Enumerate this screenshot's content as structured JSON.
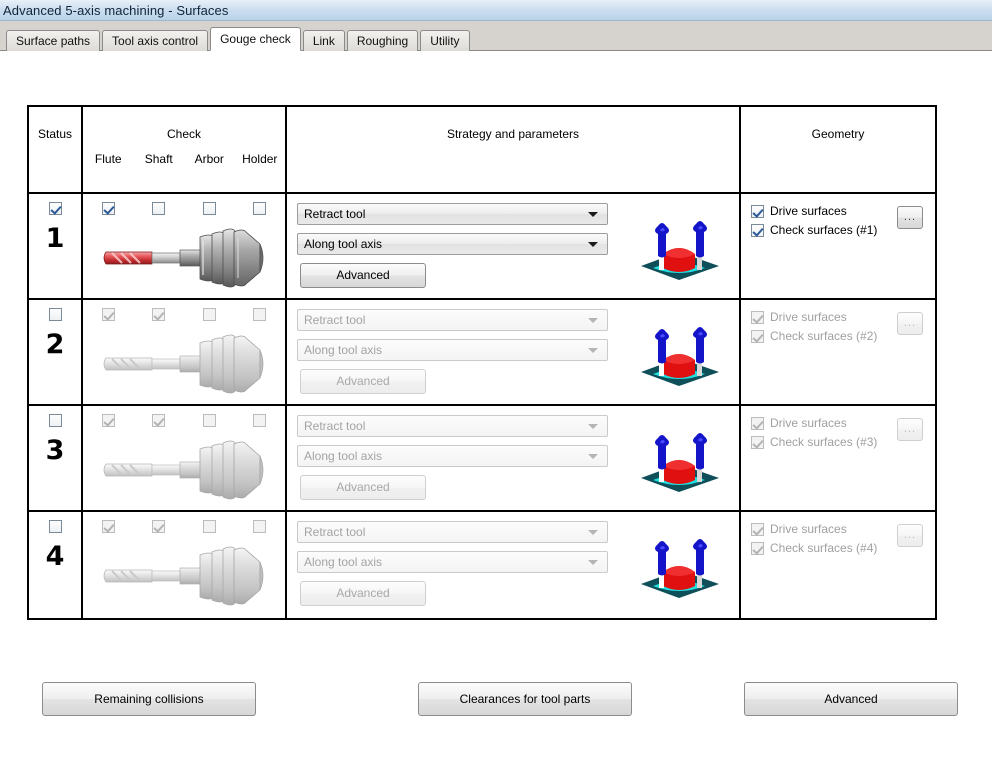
{
  "window": {
    "title": "Advanced 5-axis machining - Surfaces"
  },
  "tabs": [
    {
      "label": "Surface paths",
      "active": false
    },
    {
      "label": "Tool axis control",
      "active": false
    },
    {
      "label": "Gouge check",
      "active": true
    },
    {
      "label": "Link",
      "active": false
    },
    {
      "label": "Roughing",
      "active": false
    },
    {
      "label": "Utility",
      "active": false
    }
  ],
  "table": {
    "headers": {
      "status": "Status",
      "check": "Check",
      "check_sub": [
        "Flute",
        "Shaft",
        "Arbor",
        "Holder"
      ],
      "strategy": "Strategy and parameters",
      "geometry": "Geometry"
    },
    "rows": [
      {
        "number": "1",
        "enabled": true,
        "status_checked": true,
        "check": [
          {
            "name": "flute",
            "checked": true
          },
          {
            "name": "shaft",
            "checked": false
          },
          {
            "name": "arbor",
            "checked": false
          },
          {
            "name": "holder",
            "checked": false
          }
        ],
        "strategy": "Retract tool",
        "direction": "Along tool axis",
        "advanced_label": "Advanced",
        "geometry": {
          "drive_label": "Drive surfaces",
          "drive_checked": true,
          "check_label": "Check surfaces (#1)",
          "check_checked": true,
          "ellipsis_label": "..."
        }
      },
      {
        "number": "2",
        "enabled": false,
        "status_checked": false,
        "check": [
          {
            "name": "flute",
            "checked": true
          },
          {
            "name": "shaft",
            "checked": true
          },
          {
            "name": "arbor",
            "checked": false
          },
          {
            "name": "holder",
            "checked": false
          }
        ],
        "strategy": "Retract tool",
        "direction": "Along tool axis",
        "advanced_label": "Advanced",
        "geometry": {
          "drive_label": "Drive surfaces",
          "drive_checked": true,
          "check_label": "Check surfaces (#2)",
          "check_checked": true,
          "ellipsis_label": "..."
        }
      },
      {
        "number": "3",
        "enabled": false,
        "status_checked": false,
        "check": [
          {
            "name": "flute",
            "checked": true
          },
          {
            "name": "shaft",
            "checked": true
          },
          {
            "name": "arbor",
            "checked": false
          },
          {
            "name": "holder",
            "checked": false
          }
        ],
        "strategy": "Retract tool",
        "direction": "Along tool axis",
        "advanced_label": "Advanced",
        "geometry": {
          "drive_label": "Drive surfaces",
          "drive_checked": true,
          "check_label": "Check surfaces (#3)",
          "check_checked": true,
          "ellipsis_label": "..."
        }
      },
      {
        "number": "4",
        "enabled": false,
        "status_checked": false,
        "check": [
          {
            "name": "flute",
            "checked": true
          },
          {
            "name": "shaft",
            "checked": true
          },
          {
            "name": "arbor",
            "checked": false
          },
          {
            "name": "holder",
            "checked": false
          }
        ],
        "strategy": "Retract tool",
        "direction": "Along tool axis",
        "advanced_label": "Advanced",
        "geometry": {
          "drive_label": "Drive surfaces",
          "drive_checked": true,
          "check_label": "Check surfaces (#4)",
          "check_checked": true,
          "ellipsis_label": "..."
        }
      }
    ]
  },
  "footer": {
    "remaining_collisions": "Remaining collisions",
    "clearances_for_tool_parts": "Clearances for tool parts",
    "advanced": "Advanced"
  },
  "colors": {
    "titlebar_start": "#e8f0f8",
    "titlebar_end": "#b9d2e8",
    "tab_active_bg": "#ffffff",
    "tabstrip_bg": "#d6d3ce",
    "grid_border": "#000000",
    "checkbox_tick": "#2c5a99",
    "tool_flute_highlight": "#e8595c",
    "geometry_blue": "#1414c8",
    "geometry_red": "#e01010",
    "geometry_teal": "#0e4f59",
    "geometry_cyan": "#20e0e0",
    "disabled_text": "#a0a0a0"
  }
}
